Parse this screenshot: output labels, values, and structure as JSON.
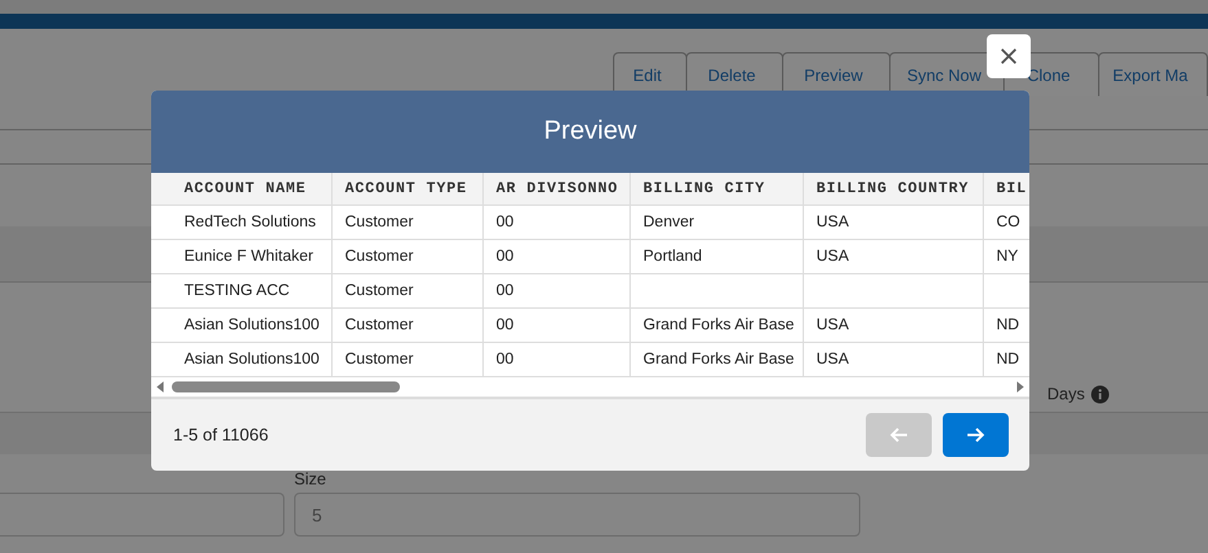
{
  "background": {
    "toolbar": [
      "Edit",
      "Delete",
      "Preview",
      "Sync Now",
      "Clone",
      "Export Ma"
    ],
    "days_label": "Days",
    "size_label": "Size",
    "size_value": "5"
  },
  "modal": {
    "title": "Preview",
    "table": {
      "columns": [
        "ACCOUNT NAME",
        "ACCOUNT TYPE",
        "AR DIVISONNO",
        "BILLING CITY",
        "BILLING COUNTRY",
        "BIL"
      ],
      "rows": [
        [
          "RedTech Solutions",
          "Customer",
          "00",
          "Denver",
          "USA",
          "CO"
        ],
        [
          "Eunice F Whitaker",
          "Customer",
          "00",
          "Portland",
          "USA",
          "NY"
        ],
        [
          "TESTING ACC",
          "Customer",
          "00",
          "",
          "",
          ""
        ],
        [
          "Asian Solutions100",
          "Customer",
          "00",
          "Grand Forks Air Base",
          "USA",
          "ND"
        ],
        [
          "Asian Solutions100",
          "Customer",
          "00",
          "Grand Forks Air Base",
          "USA",
          "ND"
        ]
      ]
    },
    "range": "1-5 of 11066",
    "pager": [
      {
        "kind": "previous",
        "disabled": true
      },
      {
        "kind": "next",
        "disabled": false
      }
    ]
  }
}
